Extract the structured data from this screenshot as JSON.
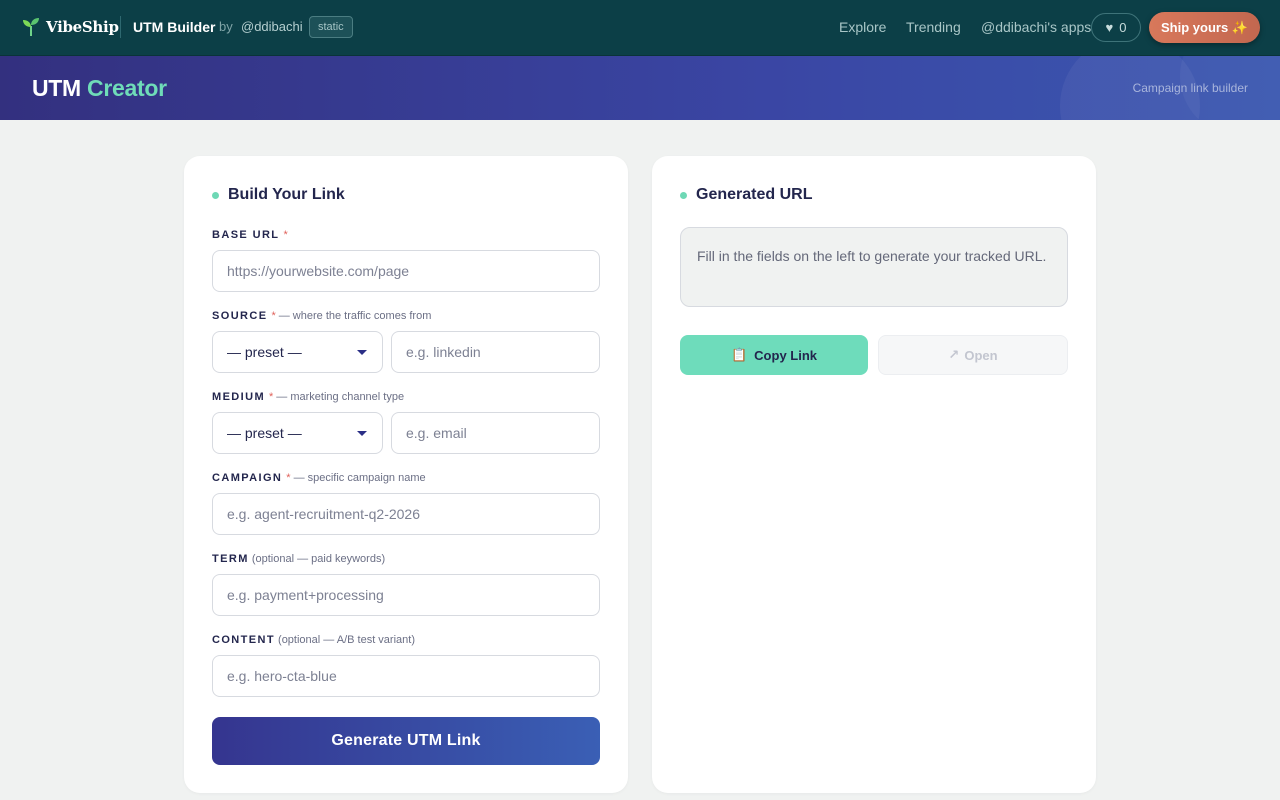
{
  "topbar": {
    "logo_text": "VibeShip",
    "app_name": "UTM Builder",
    "by_label": "by",
    "author": "@ddibachi",
    "badge": "static",
    "nav": {
      "explore": "Explore",
      "trending": "Trending",
      "apps": "@ddibachi's apps"
    },
    "like_icon": "♥",
    "like_count": "0",
    "ship_button": "Ship yours ✨"
  },
  "hero": {
    "title_main": "UTM",
    "title_accent": "Creator",
    "subtitle": "Campaign link builder"
  },
  "builder": {
    "title": "Build Your Link",
    "required_mark": "*",
    "base_url": {
      "label": "BASE URL",
      "placeholder": "https://yourwebsite.com/page"
    },
    "source": {
      "label": "SOURCE",
      "hint": "— where the traffic comes from",
      "preset": "— preset —",
      "placeholder": "e.g. linkedin"
    },
    "medium": {
      "label": "MEDIUM",
      "hint": "— marketing channel type",
      "preset": "— preset —",
      "placeholder": "e.g. email"
    },
    "campaign": {
      "label": "CAMPAIGN",
      "hint": "— specific campaign name",
      "placeholder": "e.g. agent-recruitment-q2-2026"
    },
    "term": {
      "label": "TERM",
      "hint": "(optional — paid keywords)",
      "placeholder": "e.g. payment+processing"
    },
    "content": {
      "label": "CONTENT",
      "hint": "(optional — A/B test variant)",
      "placeholder": "e.g. hero-cta-blue"
    },
    "generate_button": "Generate UTM Link"
  },
  "output": {
    "title": "Generated URL",
    "placeholder_text": "Fill in the fields on the left to generate your tracked URL.",
    "copy_icon": "📋",
    "copy_button": "Copy Link",
    "open_icon": "↗",
    "open_button": "Open"
  },
  "colors": {
    "topbar_bg": "#0c3f47",
    "accent_mint": "#6edcbb",
    "hero_start": "#33307f",
    "hero_end": "#3b58b0",
    "ship_button": "#d8785b",
    "required": "#e0615a"
  }
}
